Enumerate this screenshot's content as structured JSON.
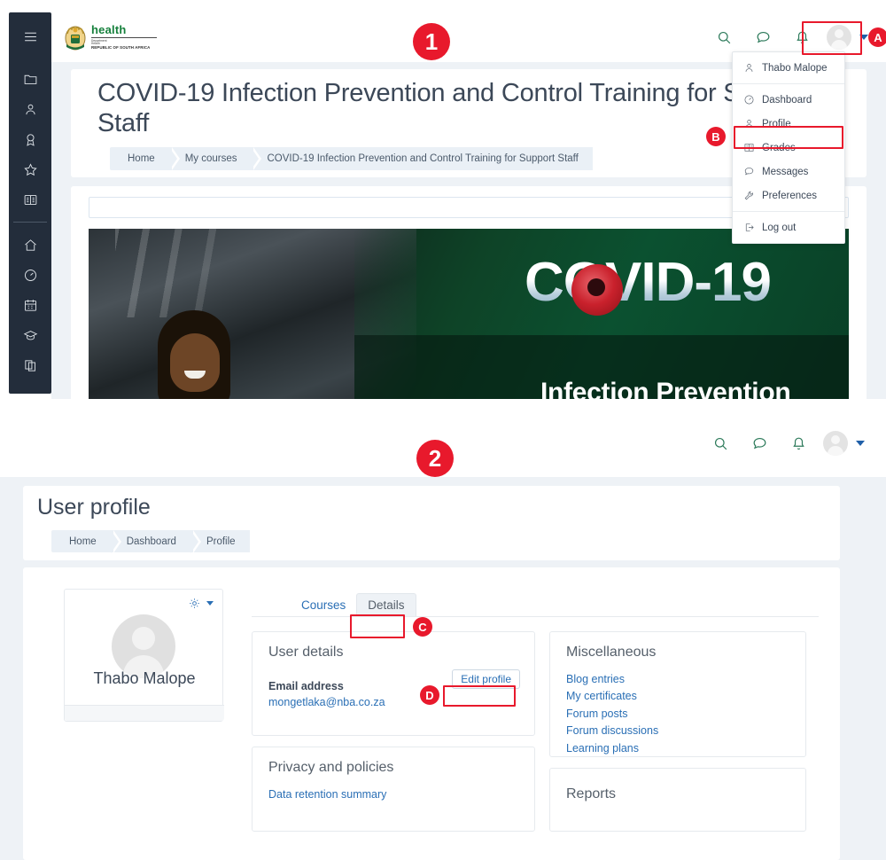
{
  "brand": {
    "logo_title": "health",
    "logo_line1": "Department",
    "logo_line2": "Health",
    "logo_line3": "REPUBLIC OF SOUTH AFRICA",
    "accent_green": "#2c7a5a",
    "marker_red": "#e8192c",
    "link_blue": "#2a6fb5"
  },
  "panel1": {
    "sidebar": {
      "items": [
        {
          "icon": "hamburger-menu-icon",
          "label": ""
        },
        {
          "icon": "folder-icon",
          "label": ""
        },
        {
          "icon": "user-profile-icon",
          "label": ""
        },
        {
          "icon": "award-badge-icon",
          "label": ""
        },
        {
          "icon": "star-icon",
          "label": ""
        },
        {
          "icon": "open-book-icon",
          "label": ""
        },
        {
          "icon": "home-icon",
          "label": ""
        },
        {
          "icon": "dashboard-gauge-icon",
          "label": ""
        },
        {
          "icon": "calendar-icon",
          "label": ""
        },
        {
          "icon": "graduation-cap-icon",
          "label": ""
        },
        {
          "icon": "files-icon",
          "label": ""
        }
      ]
    },
    "topbar_icons": [
      {
        "icon": "search-icon"
      },
      {
        "icon": "message-bubble-icon"
      },
      {
        "icon": "notification-bell-icon"
      },
      {
        "icon": "user-avatar-icon"
      },
      {
        "icon": "chevron-down-icon"
      }
    ],
    "course_title": "COVID-19 Infection Prevention and Control Training for Support Staff",
    "breadcrumb": [
      "Home",
      "My courses",
      "COVID-19 Infection Prevention and Control Training for Support Staff"
    ],
    "banner": {
      "headline": "COVID-19",
      "subheadline": "Infection Prevention"
    }
  },
  "user_menu": {
    "items": [
      {
        "icon": "user-profile-icon",
        "label": "Thabo Malope"
      },
      {
        "icon": "dashboard-gauge-icon",
        "label": "Dashboard"
      },
      {
        "icon": "user-profile-icon",
        "label": "Profile"
      },
      {
        "icon": "grades-book-icon",
        "label": "Grades"
      },
      {
        "icon": "message-bubble-icon",
        "label": "Messages"
      },
      {
        "icon": "preferences-wrench-icon",
        "label": "Preferences"
      },
      {
        "icon": "logout-icon",
        "label": "Log out"
      }
    ]
  },
  "panel2": {
    "topbar_icons": [
      {
        "icon": "search-icon"
      },
      {
        "icon": "message-bubble-icon"
      },
      {
        "icon": "notification-bell-icon"
      },
      {
        "icon": "user-avatar-icon"
      },
      {
        "icon": "chevron-down-icon"
      }
    ],
    "page_title": "User profile",
    "breadcrumb": [
      "Home",
      "Dashboard",
      "Profile"
    ],
    "profile_card": {
      "name": "Thabo Malope",
      "gear_icon": "gear-icon"
    },
    "tabs": [
      {
        "label": "Courses",
        "active": false
      },
      {
        "label": "Details",
        "active": true
      }
    ],
    "user_details": {
      "heading": "User details",
      "edit_button": "Edit profile",
      "email_label": "Email address",
      "email_value": "mongetlaka@nba.co.za"
    },
    "privacy": {
      "heading": "Privacy and policies",
      "links": [
        "Data retention summary"
      ]
    },
    "miscellaneous": {
      "heading": "Miscellaneous",
      "links": [
        "Blog entries",
        "My certificates",
        "Forum posts",
        "Forum discussions",
        "Learning plans"
      ]
    },
    "reports": {
      "heading": "Reports"
    }
  },
  "markers": {
    "one": "1",
    "two": "2",
    "a": "A",
    "b": "B",
    "c": "C",
    "d": "D"
  }
}
